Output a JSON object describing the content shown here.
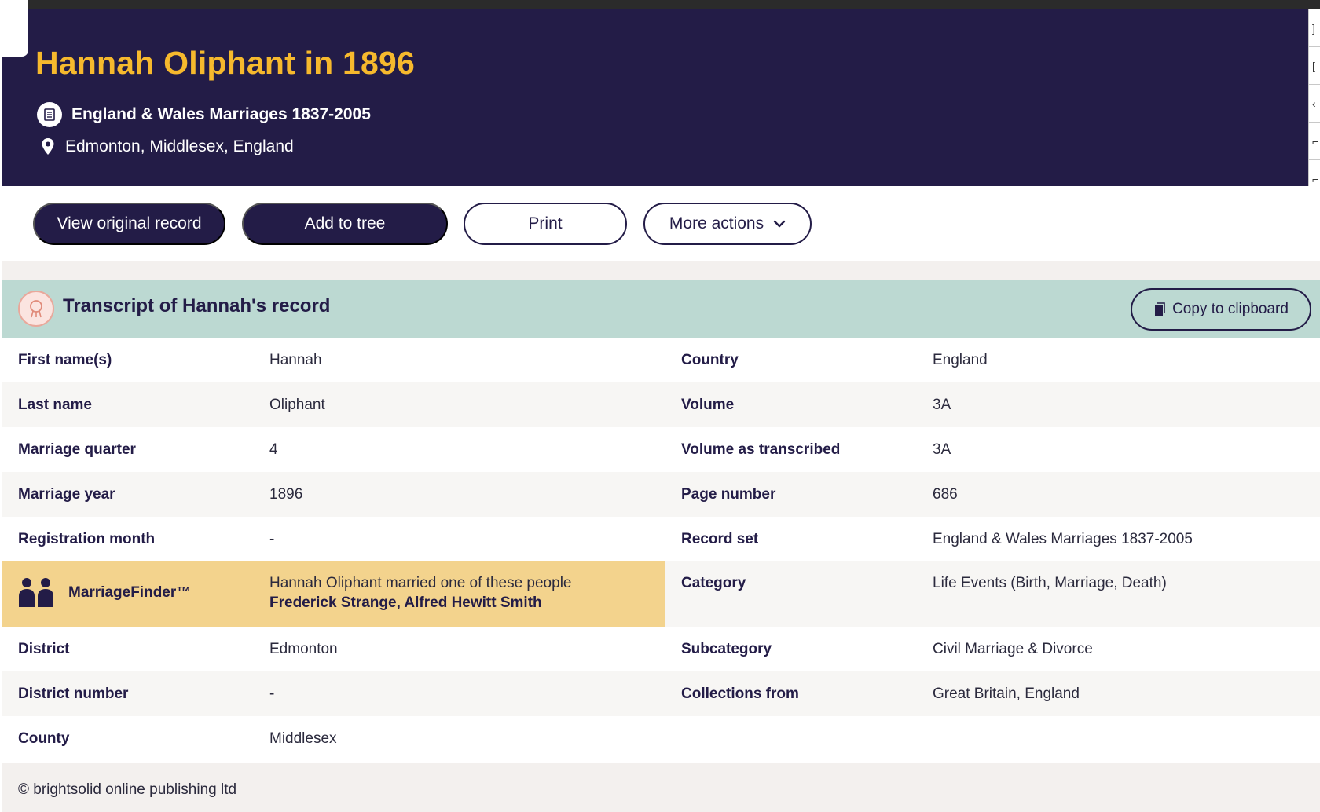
{
  "header": {
    "title": "Hannah Oliphant in 1896",
    "collection": "England & Wales Marriages 1837-2005",
    "place": "Edmonton, Middlesex, England",
    "colors": {
      "background": "#231c47",
      "title": "#f6b92d"
    }
  },
  "actions": {
    "view_original": "View original record",
    "add_to_tree": "Add to tree",
    "print": "Print",
    "more_actions": "More actions"
  },
  "transcript": {
    "title": "Transcript of Hannah's record",
    "copy_label": "Copy to clipboard"
  },
  "left_rows": [
    {
      "label": "First name(s)",
      "value": "Hannah"
    },
    {
      "label": "Last name",
      "value": "Oliphant"
    },
    {
      "label": "Marriage quarter",
      "value": "4"
    },
    {
      "label": "Marriage year",
      "value": "1896"
    },
    {
      "label": "Registration month",
      "value": "-"
    },
    {
      "label": "District",
      "value": "Edmonton"
    },
    {
      "label": "District number",
      "value": "-"
    },
    {
      "label": "County",
      "value": "Middlesex"
    }
  ],
  "marriage_finder": {
    "label": "MarriageFinder™",
    "intro": "Hannah Oliphant married one of these people",
    "names": "Frederick Strange, Alfred Hewitt Smith",
    "color": "#f3d38d"
  },
  "right_rows": [
    {
      "label": "Country",
      "value": "England"
    },
    {
      "label": "Volume",
      "value": "3A"
    },
    {
      "label": "Volume as transcribed",
      "value": "3A"
    },
    {
      "label": "Page number",
      "value": "686"
    },
    {
      "label": "Record set",
      "value": "England & Wales Marriages 1837-2005"
    },
    {
      "label": "Category",
      "value": "Life Events (Birth, Marriage, Death)"
    },
    {
      "label": "Subcategory",
      "value": "Civil Marriage & Divorce"
    },
    {
      "label": "Collections from",
      "value": "Great Britain, England"
    }
  ],
  "footer": {
    "copyright": "© brightsolid online publishing ltd"
  },
  "icons": [
    "record-book-icon",
    "location-pin-icon",
    "chevron-down-icon",
    "transcript-badge-icon",
    "clipboard-icon",
    "couple-icon"
  ]
}
